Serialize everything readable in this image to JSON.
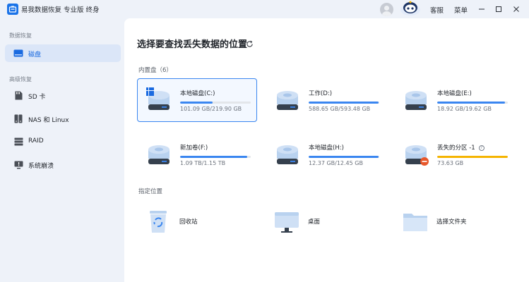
{
  "app": {
    "title": "易我数据恢复 专业版 终身"
  },
  "titlebar": {
    "links": [
      "客服",
      "菜单"
    ],
    "icons": [
      "user-avatar",
      "mascot",
      "minimize-icon",
      "maximize-icon",
      "close-icon"
    ]
  },
  "sidebar": {
    "section1": "数据恢复",
    "section2": "高级恢复",
    "items": [
      {
        "label": "磁盘",
        "icon": "disk-icon",
        "active": true
      },
      {
        "label": "SD 卡",
        "icon": "sd-card-icon",
        "active": false
      },
      {
        "label": "NAS 和 Linux",
        "icon": "nas-icon",
        "active": false
      },
      {
        "label": "RAID",
        "icon": "raid-icon",
        "active": false
      },
      {
        "label": "系统崩溃",
        "icon": "system-crash-icon",
        "active": false
      }
    ]
  },
  "main": {
    "title": "选择要查找丢失数据的位置",
    "internal_group": "内置盘（6）",
    "drives": [
      {
        "name": "本地磁盘(C:)",
        "size": "101.09 GB/219.90 GB",
        "usage": 0.46,
        "selected": true,
        "windows": true
      },
      {
        "name": "工作(D:)",
        "size": "588.65 GB/593.48 GB",
        "usage": 0.99,
        "selected": false
      },
      {
        "name": "本地磁盘(E:)",
        "size": "18.92 GB/19.62 GB",
        "usage": 0.96,
        "selected": false
      },
      {
        "name": "新加卷(F:)",
        "size": "1.09 TB/1.15 TB",
        "usage": 0.95,
        "selected": false
      },
      {
        "name": "本地磁盘(H:)",
        "size": "12.37 GB/12.45 GB",
        "usage": 0.99,
        "selected": false
      },
      {
        "name": "丢失的分区 -1",
        "size": "73.63 GB",
        "usage": 1.0,
        "selected": false,
        "lost": true,
        "bar_color": "#f5b400"
      }
    ],
    "location_group": "指定位置",
    "locations": [
      {
        "label": "回收站",
        "icon": "recycle-bin-icon"
      },
      {
        "label": "桌面",
        "icon": "desktop-icon"
      },
      {
        "label": "选择文件夹",
        "icon": "folder-icon"
      }
    ]
  },
  "colors": {
    "accent": "#3a86f0",
    "warning": "#f5b400",
    "error": "#e8572a"
  }
}
